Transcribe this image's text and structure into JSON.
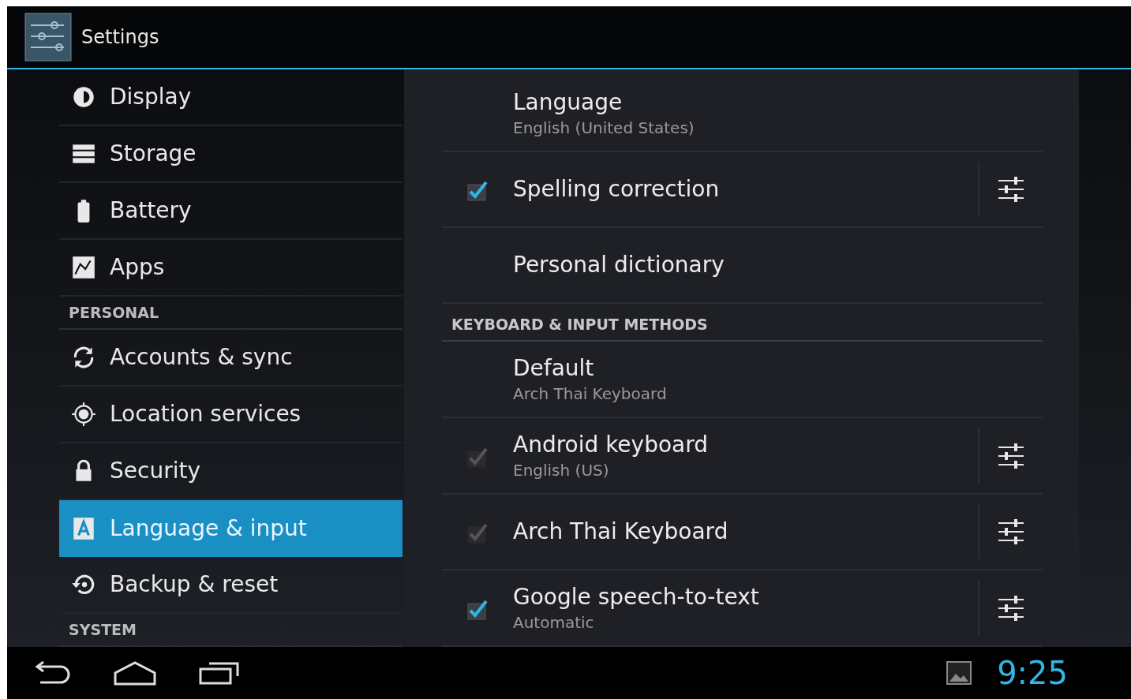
{
  "action_bar": {
    "title": "Settings"
  },
  "sidebar": {
    "items": [
      {
        "kind": "item",
        "label": "Display",
        "selected": false
      },
      {
        "kind": "item",
        "label": "Storage",
        "selected": false
      },
      {
        "kind": "item",
        "label": "Battery",
        "selected": false
      },
      {
        "kind": "item",
        "label": "Apps",
        "selected": false
      },
      {
        "kind": "header",
        "label": "PERSONAL"
      },
      {
        "kind": "item",
        "label": "Accounts & sync",
        "selected": false
      },
      {
        "kind": "item",
        "label": "Location services",
        "selected": false
      },
      {
        "kind": "item",
        "label": "Security",
        "selected": false
      },
      {
        "kind": "item",
        "label": "Language & input",
        "selected": true
      },
      {
        "kind": "item",
        "label": "Backup & reset",
        "selected": false
      },
      {
        "kind": "header",
        "label": "SYSTEM"
      }
    ]
  },
  "detail": {
    "items": [
      {
        "kind": "pref",
        "title": "Language",
        "summary": "English (United States)"
      },
      {
        "kind": "check",
        "title": "Spelling correction",
        "checked": true,
        "disabled": false,
        "settings": true
      },
      {
        "kind": "pref",
        "title": "Personal dictionary"
      },
      {
        "kind": "header",
        "title": "KEYBOARD & INPUT METHODS"
      },
      {
        "kind": "pref",
        "title": "Default",
        "summary": "Arch Thai Keyboard"
      },
      {
        "kind": "check",
        "title": "Android keyboard",
        "summary": "English (US)",
        "checked": true,
        "disabled": true,
        "settings": true
      },
      {
        "kind": "check",
        "title": "Arch Thai Keyboard",
        "checked": true,
        "disabled": true,
        "settings": true
      },
      {
        "kind": "check",
        "title": "Google speech-to-text",
        "summary": "Automatic",
        "checked": true,
        "disabled": false,
        "settings": true
      }
    ]
  },
  "system_bar": {
    "clock": "9:25"
  }
}
